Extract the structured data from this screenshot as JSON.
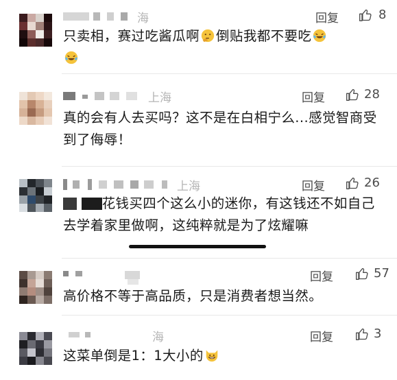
{
  "reply_label": "回复",
  "comments": [
    {
      "location": "海",
      "likes": "8",
      "text_before": "只卖相，赛过吃酱瓜啊",
      "text_middle": "倒贴我都不要吃",
      "emojis": [
        "thinking-emoji",
        "laughing-crying-emoji",
        "laughing-crying-emoji"
      ]
    },
    {
      "location": "上海",
      "likes": "28",
      "text": "真的会有人去买吗？这不是在白相宁么...感觉智商受到了侮辱！"
    },
    {
      "location": "上海",
      "likes": "26",
      "text": "花钱买四个这么小的迷你，有这钱还不如自己去学着家里做啊，这纯粹就是为了炫耀嘛"
    },
    {
      "location": "",
      "likes": "57",
      "text": "高价格不等于高品质，只是消费者想当然。"
    },
    {
      "location": "海",
      "likes": "3",
      "text": "这菜单倒是1：1大小的",
      "emojis": [
        "grinning-cat-emoji"
      ]
    }
  ],
  "colors": {
    "text": "#1a1a1a",
    "meta": "#4b4b4b",
    "location": "#b4b4b4"
  }
}
